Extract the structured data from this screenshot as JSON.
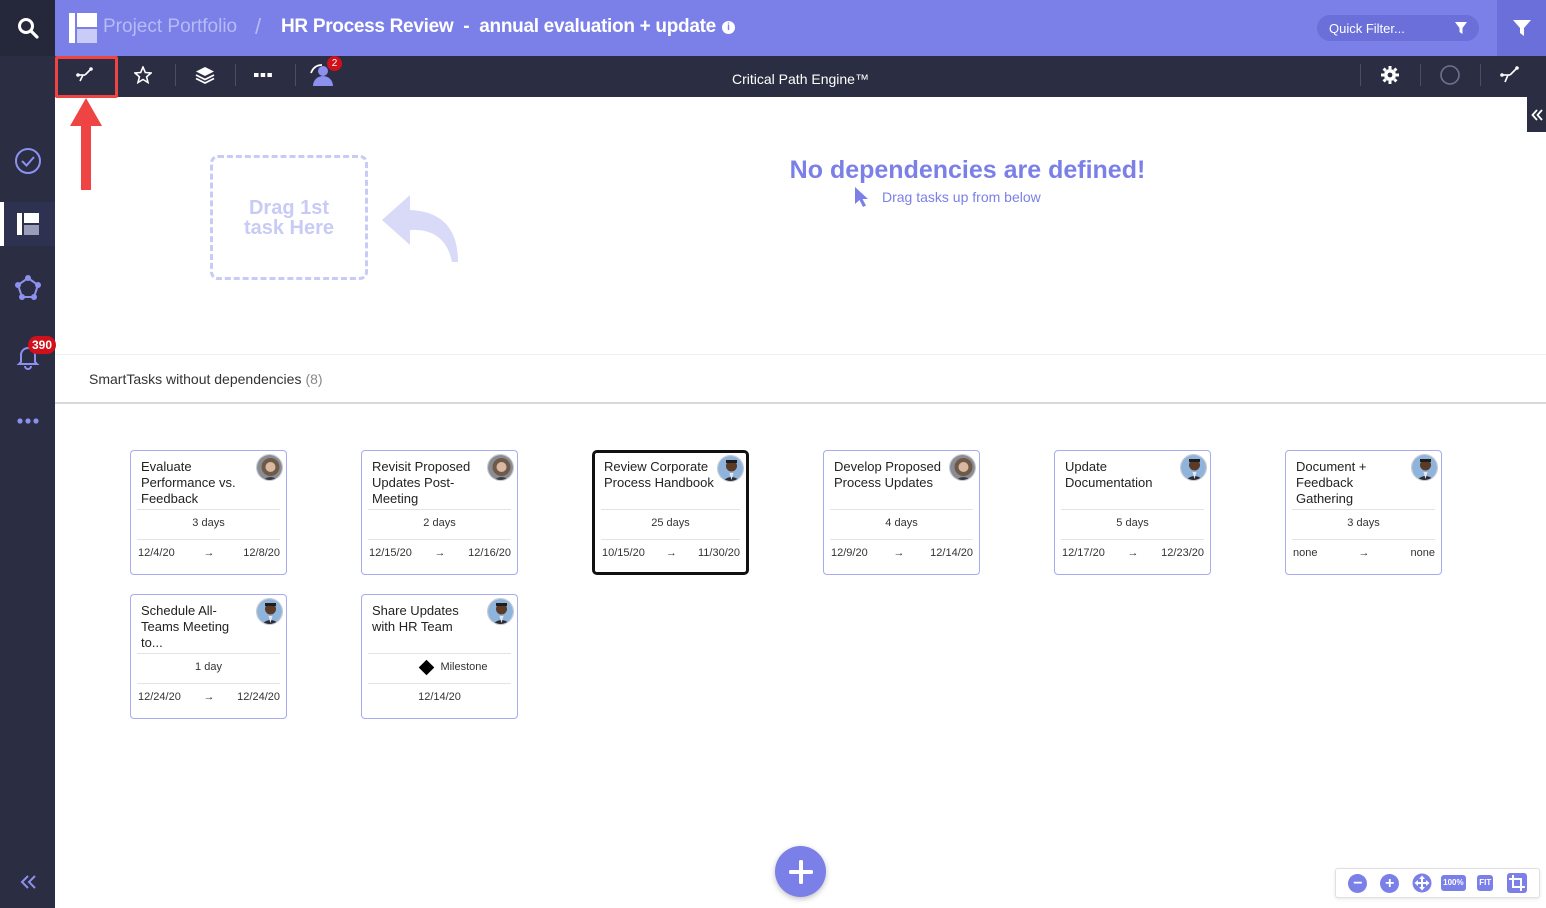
{
  "header": {
    "parent": "Project Portfolio",
    "separator": "/",
    "title": "HR Process Review  -  annual evaluation + update",
    "quick_filter": "Quick Filter..."
  },
  "sidebar": {
    "notification_count": "390"
  },
  "toolbar": {
    "title": "Critical Path Engine™",
    "share_badge": "2"
  },
  "dependencies": {
    "dropzone_line1": "Drag 1st",
    "dropzone_line2": "task Here",
    "empty_title": "No dependencies are defined!",
    "empty_subtitle": "Drag tasks up from below"
  },
  "section": {
    "title": "SmartTasks without dependencies",
    "count": "(8)"
  },
  "tasks": [
    {
      "name": "Evaluate Performance vs. Feedback",
      "duration": "3 days",
      "start": "12/4/20",
      "arrow": "→",
      "end": "12/8/20",
      "avatar": "female-avatar"
    },
    {
      "name": "Revisit Proposed Updates Post-Meeting",
      "duration": "2 days",
      "start": "12/15/20",
      "arrow": "→",
      "end": "12/16/20",
      "avatar": "female-avatar"
    },
    {
      "name": "Review Corporate Process Handbook",
      "duration": "25 days",
      "start": "10/15/20",
      "arrow": "→",
      "end": "11/30/20",
      "avatar": "male-avatar"
    },
    {
      "name": "Develop Proposed Process Updates",
      "duration": "4 days",
      "start": "12/9/20",
      "arrow": "→",
      "end": "12/14/20",
      "avatar": "female-avatar"
    },
    {
      "name": "Update Documentation",
      "duration": "5 days",
      "start": "12/17/20",
      "arrow": "→",
      "end": "12/23/20",
      "avatar": "male-avatar"
    },
    {
      "name": "Document + Feedback Gathering",
      "duration": "3 days",
      "start": "none",
      "arrow": "→",
      "end": "none",
      "avatar": "male-avatar"
    },
    {
      "name": "Schedule All-Teams Meeting to...",
      "duration": "1 day",
      "start": "12/24/20",
      "arrow": "→",
      "end": "12/24/20",
      "avatar": "male-avatar"
    },
    {
      "name": "Share Updates with HR Team",
      "milestone_label": "Milestone",
      "date": "12/14/20",
      "avatar": "male-avatar"
    }
  ],
  "zoom": {
    "percent": "100%",
    "fit": "FIT"
  },
  "colors": {
    "accent": "#7b80e8",
    "sidebar": "#2b2d42",
    "highlight": "#ef4444"
  }
}
